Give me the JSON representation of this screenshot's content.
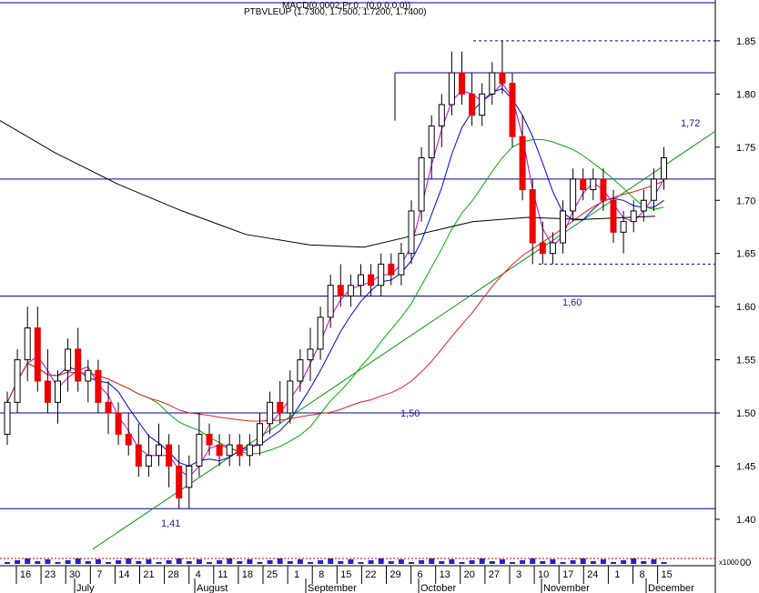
{
  "chart_data": {
    "type": "candlestick",
    "header": {
      "line1": "MACD(0.0002,Pr.0,..(0,0,0,0,0))",
      "line2": "PTBVLEUP (1.7300, 1.7500, 1.7200, 1.7400)"
    },
    "price_axis": {
      "ylim": [
        1.37,
        1.885
      ],
      "ticks": [
        "1.85",
        "1.80",
        "1.75",
        "1.70",
        "1.65",
        "1.60",
        "1.55",
        "1.50",
        "1.45",
        "1.40"
      ]
    },
    "volume_axis_label": "x1000",
    "volume_tick": "00",
    "day_labels": [
      "16",
      "23",
      "30",
      "7",
      "14",
      "21",
      "28",
      "4",
      "11",
      "18",
      "25",
      "1",
      "8",
      "15",
      "22",
      "29",
      "6",
      "13",
      "20",
      "27",
      "3",
      "10",
      "17",
      "24",
      "1",
      "8",
      "15"
    ],
    "months": [
      "July",
      "August",
      "September",
      "October",
      "November",
      "December"
    ],
    "annotations": [
      "1,72",
      "1,60",
      "1,50",
      "1,41"
    ],
    "horizontal_levels": [
      1.82,
      1.72,
      1.61,
      1.5,
      1.41
    ],
    "dashed_levels": [
      1.85,
      1.64
    ],
    "trendline": {
      "from": [
        0,
        1.372
      ],
      "to": [
        39.5,
        1.765
      ]
    },
    "candles": [
      [
        1.48,
        1.52,
        1.47,
        1.51
      ],
      [
        1.51,
        1.56,
        1.5,
        1.55
      ],
      [
        1.55,
        1.6,
        1.53,
        1.58
      ],
      [
        1.58,
        1.6,
        1.52,
        1.53
      ],
      [
        1.53,
        1.56,
        1.5,
        1.51
      ],
      [
        1.51,
        1.54,
        1.49,
        1.53
      ],
      [
        1.54,
        1.57,
        1.52,
        1.56
      ],
      [
        1.56,
        1.58,
        1.52,
        1.53
      ],
      [
        1.53,
        1.55,
        1.51,
        1.54
      ],
      [
        1.54,
        1.55,
        1.5,
        1.51
      ],
      [
        1.51,
        1.53,
        1.48,
        1.5
      ],
      [
        1.5,
        1.51,
        1.47,
        1.48
      ],
      [
        1.48,
        1.5,
        1.46,
        1.47
      ],
      [
        1.47,
        1.49,
        1.44,
        1.45
      ],
      [
        1.45,
        1.48,
        1.44,
        1.46
      ],
      [
        1.46,
        1.49,
        1.45,
        1.47
      ],
      [
        1.47,
        1.48,
        1.43,
        1.45
      ],
      [
        1.45,
        1.47,
        1.41,
        1.42
      ],
      [
        1.43,
        1.46,
        1.41,
        1.45
      ],
      [
        1.45,
        1.5,
        1.44,
        1.48
      ],
      [
        1.48,
        1.49,
        1.46,
        1.47
      ],
      [
        1.47,
        1.48,
        1.45,
        1.46
      ],
      [
        1.46,
        1.48,
        1.45,
        1.47
      ],
      [
        1.47,
        1.48,
        1.45,
        1.46
      ],
      [
        1.46,
        1.48,
        1.45,
        1.47
      ],
      [
        1.47,
        1.5,
        1.46,
        1.49
      ],
      [
        1.49,
        1.52,
        1.48,
        1.51
      ],
      [
        1.51,
        1.53,
        1.49,
        1.5
      ],
      [
        1.5,
        1.54,
        1.49,
        1.53
      ],
      [
        1.53,
        1.56,
        1.52,
        1.55
      ],
      [
        1.55,
        1.58,
        1.53,
        1.56
      ],
      [
        1.56,
        1.6,
        1.55,
        1.59
      ],
      [
        1.59,
        1.63,
        1.58,
        1.62
      ],
      [
        1.62,
        1.64,
        1.6,
        1.61
      ],
      [
        1.61,
        1.63,
        1.6,
        1.62
      ],
      [
        1.62,
        1.64,
        1.61,
        1.63
      ],
      [
        1.63,
        1.64,
        1.61,
        1.62
      ],
      [
        1.62,
        1.65,
        1.61,
        1.64
      ],
      [
        1.64,
        1.65,
        1.62,
        1.63
      ],
      [
        1.63,
        1.66,
        1.62,
        1.65
      ],
      [
        1.65,
        1.7,
        1.64,
        1.69
      ],
      [
        1.69,
        1.75,
        1.68,
        1.74
      ],
      [
        1.74,
        1.78,
        1.72,
        1.77
      ],
      [
        1.77,
        1.8,
        1.75,
        1.79
      ],
      [
        1.79,
        1.84,
        1.78,
        1.82
      ],
      [
        1.82,
        1.84,
        1.79,
        1.8
      ],
      [
        1.8,
        1.82,
        1.77,
        1.78
      ],
      [
        1.78,
        1.81,
        1.77,
        1.8
      ],
      [
        1.8,
        1.83,
        1.79,
        1.82
      ],
      [
        1.82,
        1.85,
        1.8,
        1.81
      ],
      [
        1.81,
        1.82,
        1.75,
        1.76
      ],
      [
        1.76,
        1.78,
        1.7,
        1.71
      ],
      [
        1.71,
        1.72,
        1.64,
        1.66
      ],
      [
        1.66,
        1.68,
        1.64,
        1.65
      ],
      [
        1.65,
        1.67,
        1.64,
        1.66
      ],
      [
        1.66,
        1.7,
        1.65,
        1.69
      ],
      [
        1.69,
        1.73,
        1.68,
        1.72
      ],
      [
        1.72,
        1.73,
        1.7,
        1.71
      ],
      [
        1.71,
        1.73,
        1.7,
        1.72
      ],
      [
        1.72,
        1.73,
        1.69,
        1.7
      ],
      [
        1.7,
        1.71,
        1.66,
        1.67
      ],
      [
        1.67,
        1.69,
        1.65,
        1.68
      ],
      [
        1.68,
        1.7,
        1.67,
        1.69
      ],
      [
        1.69,
        1.71,
        1.68,
        1.7
      ],
      [
        1.7,
        1.73,
        1.69,
        1.72
      ],
      [
        1.72,
        1.75,
        1.71,
        1.74
      ]
    ],
    "indicator_colors": {
      "ma_200": "#000000",
      "ma_long": "#e02020",
      "ma_mid": "#00b000",
      "ma_short": "#0000ee",
      "ma_fast": "#cc00cc",
      "trendline": "#009900",
      "levels": "#0000aa",
      "up_candle": "#ffffff",
      "down_candle": "#ee0000"
    }
  }
}
